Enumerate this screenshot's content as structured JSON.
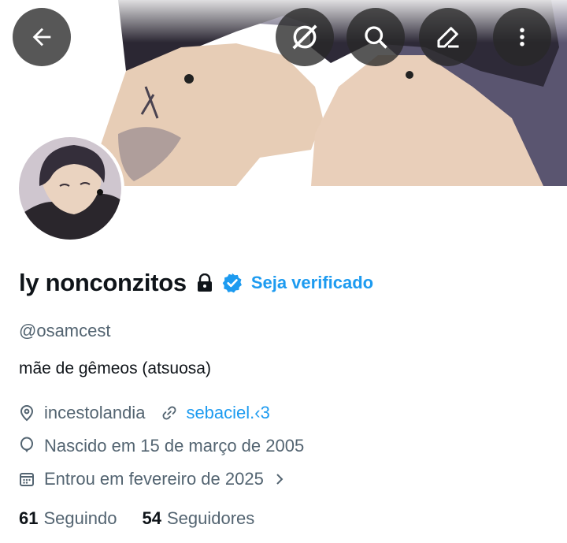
{
  "header": {
    "back_icon": "arrow-left-icon",
    "grok_icon": "grok-icon",
    "search_icon": "search-icon",
    "edit_icon": "pencil-icon",
    "more_icon": "more-vertical-icon"
  },
  "profile": {
    "name": "ly nonconzitos",
    "protected_icon": "lock-icon",
    "verified_icon": "verified-badge-icon",
    "get_verified_label": "Seja verificado",
    "handle": "@osamcest",
    "bio": "mãe de gêmeos (atsuosa)",
    "location": "incestolandia",
    "website": "sebaciel.‹3",
    "birthday": "Nascido em 15 de março de 2005",
    "joined": "Entrou em fevereiro de 2025",
    "following_count": "61",
    "following_label": "Seguindo",
    "followers_count": "54",
    "followers_label": "Seguidores"
  },
  "colors": {
    "accent": "#1d9bf0",
    "secondary_text": "#536471",
    "primary_text": "#0f1419"
  }
}
